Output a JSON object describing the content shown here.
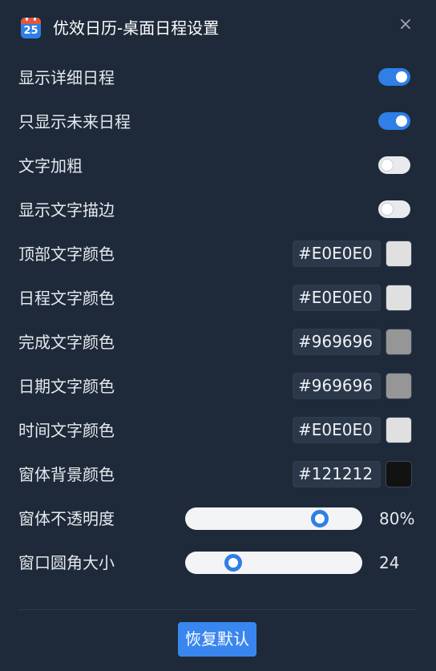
{
  "window": {
    "title": "优效日历-桌面日程设置",
    "app_icon": "calendar-icon",
    "app_icon_day": "25",
    "close_icon": "close-icon",
    "close_glyph": "×"
  },
  "toggles": [
    {
      "label": "显示详细日程",
      "on": true
    },
    {
      "label": "只显示未来日程",
      "on": true
    },
    {
      "label": "文字加粗",
      "on": false
    },
    {
      "label": "显示文字描边",
      "on": false
    }
  ],
  "colors": [
    {
      "label": "顶部文字颜色",
      "value": "#E0E0E0",
      "swatch": "#e0e0e0"
    },
    {
      "label": "日程文字颜色",
      "value": "#E0E0E0",
      "swatch": "#e0e0e0"
    },
    {
      "label": "完成文字颜色",
      "value": "#969696",
      "swatch": "#969696"
    },
    {
      "label": "日期文字颜色",
      "value": "#969696",
      "swatch": "#969696"
    },
    {
      "label": "时间文字颜色",
      "value": "#E0E0E0",
      "swatch": "#e0e0e0"
    },
    {
      "label": "窗体背景颜色",
      "value": "#121212",
      "swatch": "#121212"
    }
  ],
  "sliders": [
    {
      "label": "窗体不透明度",
      "value_text": "80%",
      "fraction": 0.8
    },
    {
      "label": "窗口圆角大小",
      "value_text": "24",
      "fraction": 0.24
    }
  ],
  "footer": {
    "reset_label": "恢复默认"
  },
  "theme": {
    "accent": "#2f7fe6",
    "background": "#1e2a3a"
  }
}
